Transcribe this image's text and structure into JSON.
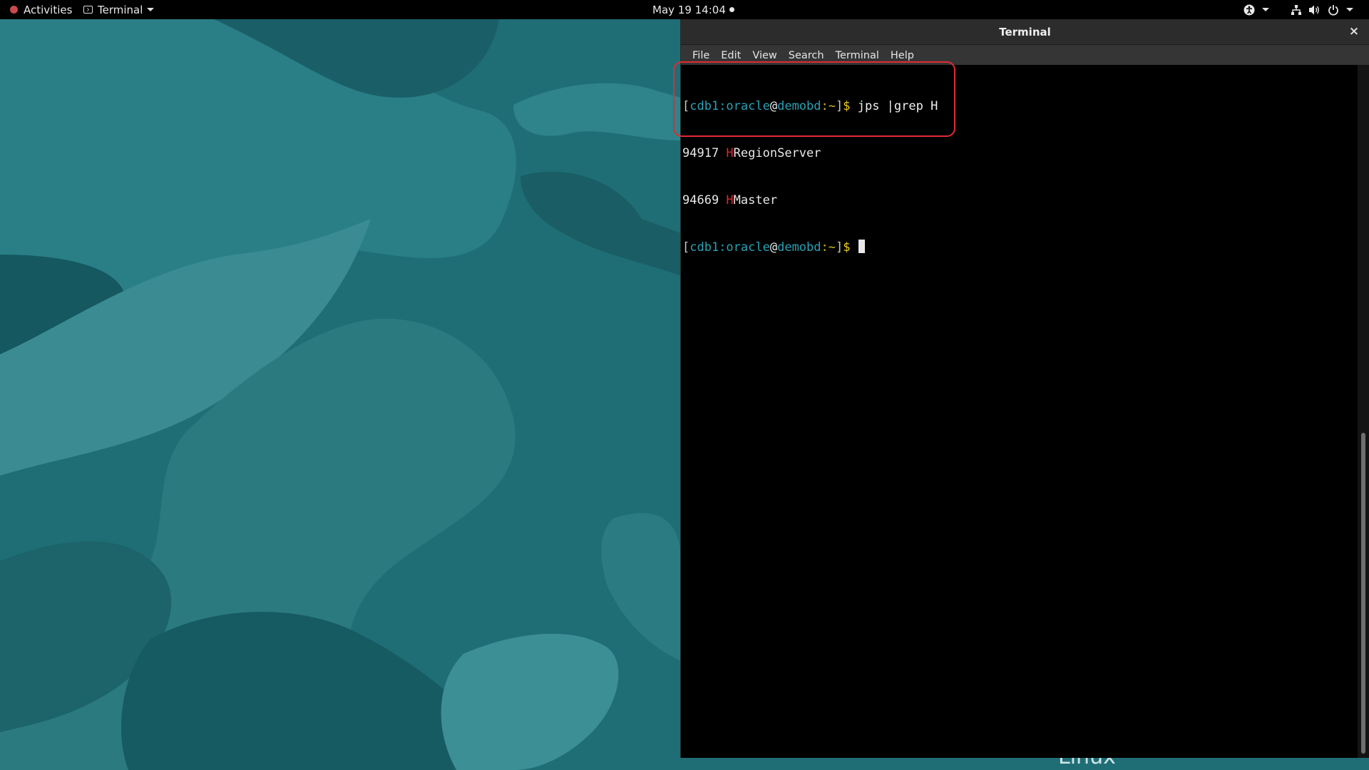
{
  "topbar": {
    "activities_label": "Activities",
    "app_menu_label": "Terminal",
    "clock": "May 19  14:04",
    "icons": [
      "accessibility-icon",
      "network-icon",
      "volume-icon",
      "power-icon"
    ]
  },
  "window": {
    "title": "Terminal",
    "close_glyph": "×",
    "menu": [
      "File",
      "Edit",
      "View",
      "Search",
      "Terminal",
      "Help"
    ]
  },
  "terminal": {
    "prompt1": {
      "open": "[",
      "user": "cdb1:oracle",
      "at": "@",
      "host": "demobd",
      "path": ":~",
      "close": "]",
      "dollar": "$",
      "command": " jps |grep H"
    },
    "output": [
      {
        "pid": "94917 ",
        "match": "H",
        "rest": "RegionServer"
      },
      {
        "pid": "94669 ",
        "match": "H",
        "rest": "Master"
      }
    ],
    "prompt2": {
      "open": "[",
      "user": "cdb1:oracle",
      "at": "@",
      "host": "demobd",
      "path": ":~",
      "close": "]",
      "dollar": "$",
      "command": " "
    }
  },
  "wallpaper_text": "Linux",
  "colors": {
    "prompt_user": "#2aa1b3",
    "prompt_dollar": "#f2d21b",
    "grep_match": "#e3262a",
    "annotation": "#e12b34",
    "wallpaper_base": "#1f6f77"
  }
}
